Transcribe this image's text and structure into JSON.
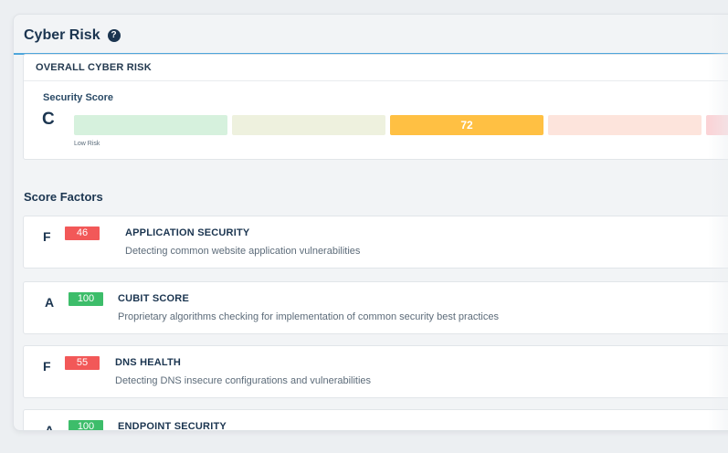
{
  "panel": {
    "title": "Cyber Risk",
    "help_icon": "?"
  },
  "overall": {
    "header": "OVERALL CYBER RISK",
    "security_score_label": "Security Score",
    "grade": "C",
    "score": "72",
    "low_risk_label": "Low Risk",
    "colors": {
      "seg1": "#d6f1dd",
      "seg2": "#eef1de",
      "active": "#ffc043",
      "seg4": "#fde4dc",
      "seg5": "#fbd3d6"
    }
  },
  "factors_heading": "Score Factors",
  "factors": [
    {
      "grade": "F",
      "score": "46",
      "color": "#f25858",
      "title": "APPLICATION SECURITY",
      "desc": "Detecting common website application vulnerabilities"
    },
    {
      "grade": "A",
      "score": "100",
      "color": "#3dbd6a",
      "title": "CUBIT SCORE",
      "desc": "Proprietary algorithms checking for implementation of common security best practices"
    },
    {
      "grade": "F",
      "score": "55",
      "color": "#f25858",
      "title": "DNS HEALTH",
      "desc": "Detecting DNS insecure configurations and vulnerabilities"
    },
    {
      "grade": "A",
      "score": "100",
      "color": "#3dbd6a",
      "title": "ENDPOINT SECURITY",
      "desc": ""
    }
  ]
}
